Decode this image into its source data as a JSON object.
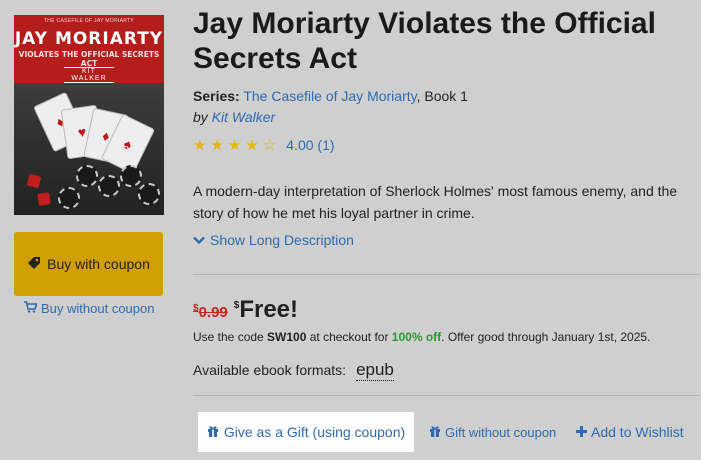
{
  "book": {
    "title": "Jay Moriarty Violates the Official Secrets Act",
    "series_label": "Series:",
    "series_name": "The Casefile of Jay Moriarty",
    "series_suffix": ", Book 1",
    "by_label": "by",
    "author": "Kit Walker",
    "rating_stars": 4,
    "rating_text": "4.00 (1)",
    "description": "A modern-day interpretation of Sherlock Holmes' most famous enemy, and the story of how he met his loyal partner in crime.",
    "long_description_label": "Show Long Description"
  },
  "cover": {
    "series_text": "THE CASEFILE OF JAY MORIARTY",
    "title_text": "JAY MORIARTY",
    "subtitle_text": "VIOLATES THE OFFICIAL SECRETS ACT",
    "author_text": "KIT WALKER"
  },
  "actions": {
    "buy_coupon_label": "Buy with coupon",
    "buy_no_coupon_label": "Buy without coupon",
    "gift_coupon_label": "Give as a Gift (using coupon)",
    "gift_no_coupon_label": "Gift without coupon",
    "wishlist_label": "Add to Wishlist"
  },
  "pricing": {
    "currency": "$",
    "old_price": "0.99",
    "new_price": "Free!",
    "code_prefix": "Use the code ",
    "code": "SW100",
    "code_middle": " at checkout for ",
    "discount": "100% off",
    "code_suffix": ". Offer good through January 1st, 2025."
  },
  "formats": {
    "label": "Available ebook formats:",
    "items": [
      "epub"
    ]
  },
  "colors": {
    "accent_link": "#2f6bb0",
    "coupon_button": "#d29f00",
    "old_price": "#cc2222",
    "discount": "#2b9a2b",
    "star": "#e6b800"
  },
  "icons": {
    "coupon": "tag-icon",
    "cart": "cart-icon",
    "chevron": "chevron-down-icon",
    "gift": "gift-icon",
    "plus": "plus-icon",
    "star": "star-icon"
  }
}
